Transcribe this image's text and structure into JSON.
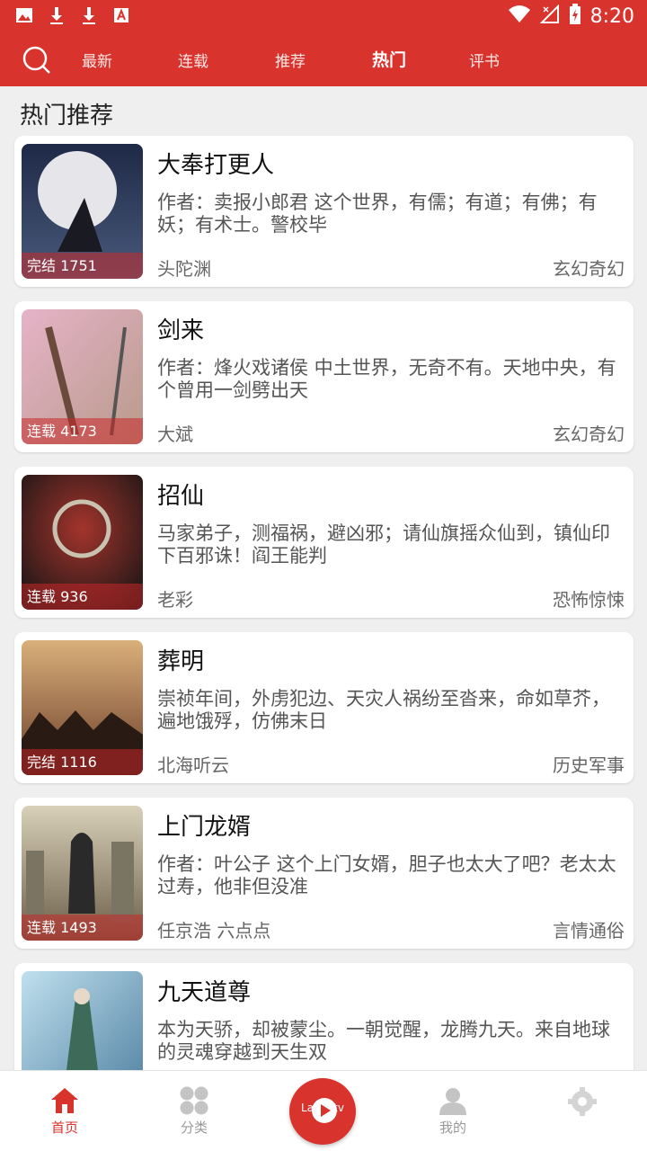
{
  "status_bar": {
    "time": "8:20"
  },
  "nav": {
    "tabs": [
      {
        "label": "最新",
        "active": false
      },
      {
        "label": "连载",
        "active": false
      },
      {
        "label": "推荐",
        "active": false
      },
      {
        "label": "热门",
        "active": true
      },
      {
        "label": "评书",
        "active": false
      }
    ]
  },
  "section_title": "热门推荐",
  "books": [
    {
      "title": "大奉打更人",
      "desc": "作者：卖报小郎君 这个世界，有儒；有道；有佛；有妖；有术士。警校毕",
      "author": "头陀渊",
      "category": "玄幻奇幻",
      "badge": "完结 1751",
      "cover_color": "#2c3a5c"
    },
    {
      "title": "剑来",
      "desc": "作者：烽火戏诸侯 中土世界，无奇不有。天地中央，有个曾用一剑劈出天",
      "author": "大斌",
      "category": "玄幻奇幻",
      "badge": "连载 4173",
      "cover_color": "#c9a0b8"
    },
    {
      "title": "招仙",
      "desc": "马家弟子，测福祸，避凶邪；请仙旗摇众仙到，镇仙印下百邪诛！阎王能判",
      "author": "老彩",
      "category": "恐怖惊悚",
      "badge": "连载 936",
      "cover_color": "#3a2a2a"
    },
    {
      "title": "葬明",
      "desc": "崇祯年间，外虏犯边、天灾人祸纷至沓来，命如草芥，遍地饿殍，仿佛末日",
      "author": "北海听云",
      "category": "历史军事",
      "badge": "完结 1116",
      "cover_color": "#b9874f"
    },
    {
      "title": "上门龙婿",
      "desc": "作者：叶公子 这个上门女婿，胆子也太大了吧？老太太过寿，他非但没准",
      "author": "任京浩 六点点",
      "category": "言情通俗",
      "badge": "连载 1493",
      "cover_color": "#8c8470"
    },
    {
      "title": "九天道尊",
      "desc": "本为天骄，却被蒙尘。一朝觉醒，龙腾九天。来自地球的灵魂穿越到天生双",
      "author": "",
      "category": "",
      "badge": "",
      "cover_color": "#5b8fb0"
    }
  ],
  "bottom_nav": {
    "items": [
      {
        "label": "首页",
        "active": true
      },
      {
        "label": "分类",
        "active": false
      },
      {
        "label": "我的",
        "active": false
      }
    ],
    "center_text": "Laodi.tv"
  }
}
